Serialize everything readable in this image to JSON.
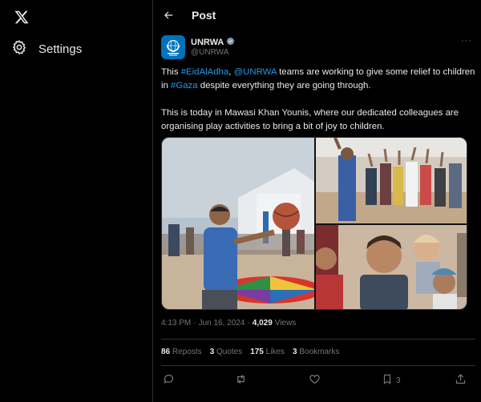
{
  "nav": {
    "logo_icon": "x-logo-icon",
    "settings_label": "Settings"
  },
  "header": {
    "title": "Post"
  },
  "author": {
    "name": "UNRWA",
    "handle": "@UNRWA",
    "verified_color": "#829aab",
    "avatar_color": "#0072bc"
  },
  "tweet": {
    "line1_prefix": "This ",
    "hashtag1": "#EidAlAdha",
    "line1_sep": ", ",
    "mention1": "@UNRWA",
    "line1_rest": " teams are working to give some relief to children in ",
    "hashtag2": "#Gaza",
    "line1_suffix": " despite everything they are going through.",
    "paragraph2": "This is today in Mawasi Khan Younis, where our dedicated colleagues are organising play activities to bring a bit of joy to children."
  },
  "meta": {
    "time": "4:13 PM",
    "sep": "·",
    "date": "Jun 16, 2024",
    "sep2": "·",
    "views_count": "4,029",
    "views_label": "Views"
  },
  "stats": {
    "reposts_count": "86",
    "reposts_label": "Reposts",
    "quotes_count": "3",
    "quotes_label": "Quotes",
    "likes_count": "175",
    "likes_label": "Likes",
    "bookmarks_count": "3",
    "bookmarks_label": "Bookmarks"
  },
  "actions": {
    "bookmark_count": "3"
  },
  "colors": {
    "link": "#1d9bf0",
    "muted": "#71767b",
    "text": "#e7e9ea",
    "border": "#2f3336"
  }
}
